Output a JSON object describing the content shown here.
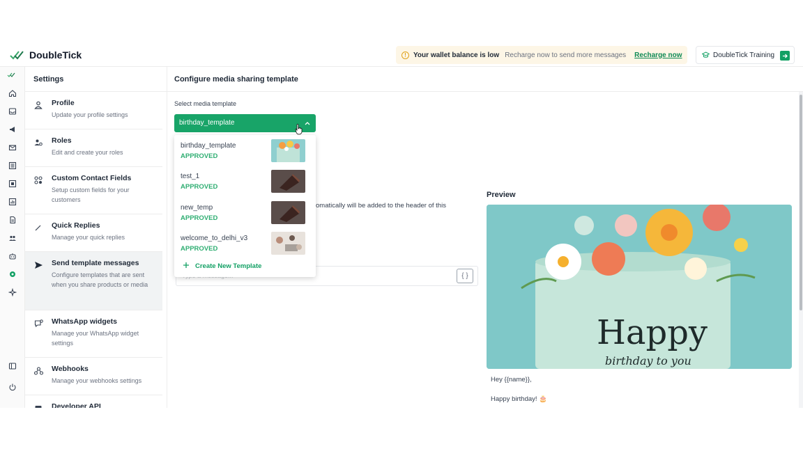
{
  "header": {
    "brand": "DoubleTick",
    "wallet_title": "Your wallet balance is low",
    "wallet_message": "Recharge now to send more messages",
    "wallet_link": "Recharge now",
    "training_label": "DoubleTick Training"
  },
  "settings": {
    "title": "Settings",
    "items": [
      {
        "label": "Profile",
        "desc": "Update your profile settings",
        "icon": "person-icon"
      },
      {
        "label": "Roles",
        "desc": "Edit and create your roles",
        "icon": "roles-icon"
      },
      {
        "label": "Custom Contact Fields",
        "desc": "Setup custom fields for your customers",
        "icon": "custom-fields-icon"
      },
      {
        "label": "Quick Replies",
        "desc": "Manage your quick replies",
        "icon": "pencil-icon"
      },
      {
        "label": "Send template messages",
        "desc": "Configure templates that are sent when you share products or media",
        "icon": "send-icon"
      },
      {
        "label": "WhatsApp widgets",
        "desc": "Manage your WhatsApp widget settings",
        "icon": "widget-icon"
      },
      {
        "label": "Webhooks",
        "desc": "Manage your webhooks settings",
        "icon": "webhook-icon"
      },
      {
        "label": "Developer API",
        "desc": "",
        "icon": "api-icon"
      }
    ]
  },
  "main": {
    "title": "Configure media sharing template",
    "select_label": "Select media template",
    "selected": "birthday_template",
    "options": [
      {
        "name": "birthday_template",
        "status": "APPROVED"
      },
      {
        "name": "test_1",
        "status": "APPROVED"
      },
      {
        "name": "new_temp",
        "status": "APPROVED"
      },
      {
        "name": "welcome_to_delhi_v3",
        "status": "APPROVED"
      }
    ],
    "create_new": "Create New Template",
    "background_text": "omatically will be added to the header of this",
    "variable_placeholder": "Type a message...",
    "variable_button": "{ }",
    "preview_label": "Preview",
    "preview_image_text": "Happy",
    "preview_image_subtext": "birthday to you",
    "preview_lines": [
      "Hey {{name}},",
      "Happy birthday! 🎂"
    ]
  },
  "colors": {
    "accent": "#18a468",
    "approved": "#2fae72",
    "wallet_bg": "#fdf6e6"
  }
}
